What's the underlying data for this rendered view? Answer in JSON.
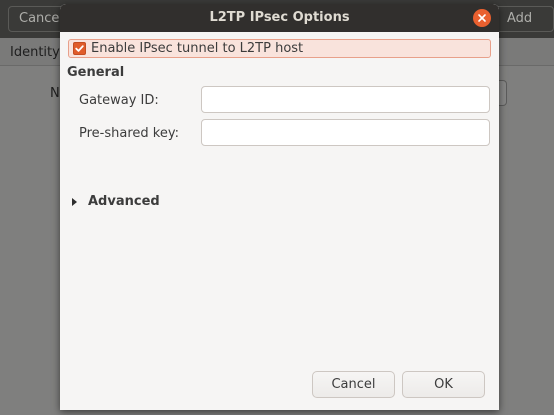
{
  "background": {
    "cancel_label": "Cance",
    "add_label": "Add",
    "tab_label": "Identity",
    "row_label": "N"
  },
  "dialog": {
    "title": "L2TP IPsec Options",
    "enable_ipsec": {
      "label": "Enable IPsec tunnel to L2TP host",
      "checked": true
    },
    "general_title": "General",
    "gateway_id": {
      "label": "Gateway ID:",
      "value": ""
    },
    "pre_shared_key": {
      "label": "Pre-shared key:",
      "value": ""
    },
    "advanced": {
      "label": "Advanced",
      "expanded": false
    },
    "buttons": {
      "cancel": "Cancel",
      "ok": "OK"
    }
  },
  "colors": {
    "accent": "#e05c2a",
    "titlebar": "#312f2d",
    "dialog_bg": "#f6f5f4",
    "close_button": "#e9602f"
  },
  "icons": {
    "close": "close-icon",
    "check": "checkmark-icon",
    "expander": "triangle-right-icon"
  }
}
